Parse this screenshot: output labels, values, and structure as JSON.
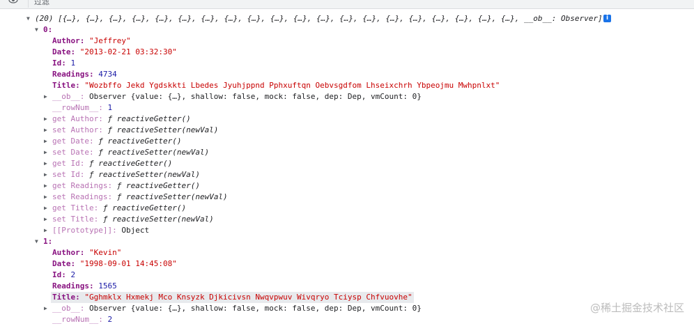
{
  "toolbar": {
    "filter_placeholder": "过滤"
  },
  "summary": {
    "count": "(20)",
    "items": "[{…}, {…}, {…}, {…}, {…}, {…}, {…}, {…}, {…}, {…}, {…}, {…}, {…}, {…}, {…}, {…}, {…}, {…}, {…}, {…}, __ob__: Observer]"
  },
  "items": [
    {
      "index": "0:",
      "fields": [
        {
          "key": "Author",
          "value": "\"Jeffrey\"",
          "type": "s"
        },
        {
          "key": "Date",
          "value": "\"2013-02-21 03:32:30\"",
          "type": "s"
        },
        {
          "key": "Id",
          "value": "1",
          "type": "n"
        },
        {
          "key": "Readings",
          "value": "4734",
          "type": "n"
        },
        {
          "key": "Title",
          "value": "\"Wozbffo Jekd Ygdskkti Lbedes Jyuhjppnd Pphxuftqn Oebvsgdfom Lhseixchrh Ybpeojmu Mwhpnlxt\"",
          "type": "s"
        }
      ],
      "ob": {
        "key": "__ob__",
        "value": "Observer {value: {…}, shallow: false, mock: false, dep: Dep, vmCount: 0}"
      },
      "rownum": {
        "key": "__rowNum__",
        "value": "1"
      },
      "accessors": [
        {
          "label": "get Author",
          "fn": "reactiveGetter()"
        },
        {
          "label": "set Author",
          "fn": "reactiveSetter(newVal)"
        },
        {
          "label": "get Date",
          "fn": "reactiveGetter()"
        },
        {
          "label": "set Date",
          "fn": "reactiveSetter(newVal)"
        },
        {
          "label": "get Id",
          "fn": "reactiveGetter()"
        },
        {
          "label": "set Id",
          "fn": "reactiveSetter(newVal)"
        },
        {
          "label": "get Readings",
          "fn": "reactiveGetter()"
        },
        {
          "label": "set Readings",
          "fn": "reactiveSetter(newVal)"
        },
        {
          "label": "get Title",
          "fn": "reactiveGetter()"
        },
        {
          "label": "set Title",
          "fn": "reactiveSetter(newVal)"
        }
      ],
      "proto": {
        "key": "[[Prototype]]",
        "value": "Object"
      }
    },
    {
      "index": "1:",
      "fields": [
        {
          "key": "Author",
          "value": "\"Kevin\"",
          "type": "s"
        },
        {
          "key": "Date",
          "value": "\"1998-09-01 14:45:08\"",
          "type": "s"
        },
        {
          "key": "Id",
          "value": "2",
          "type": "n"
        },
        {
          "key": "Readings",
          "value": "1565",
          "type": "n"
        },
        {
          "key": "Title",
          "value": "\"Gghmklx Hxmekj Mco Knsyzk Djkicivsn Nwqvpwuv Wivqryo Tciysp Chfvuovhe\"",
          "type": "s"
        }
      ],
      "ob": {
        "key": "__ob__",
        "value": "Observer {value: {…}, shallow: false, mock: false, dep: Dep, vmCount: 0}"
      },
      "rownum": {
        "key": "__rowNum__",
        "value": "2"
      }
    }
  ],
  "fn_symbol": "ƒ",
  "watermark": "@稀土掘金技术社区"
}
